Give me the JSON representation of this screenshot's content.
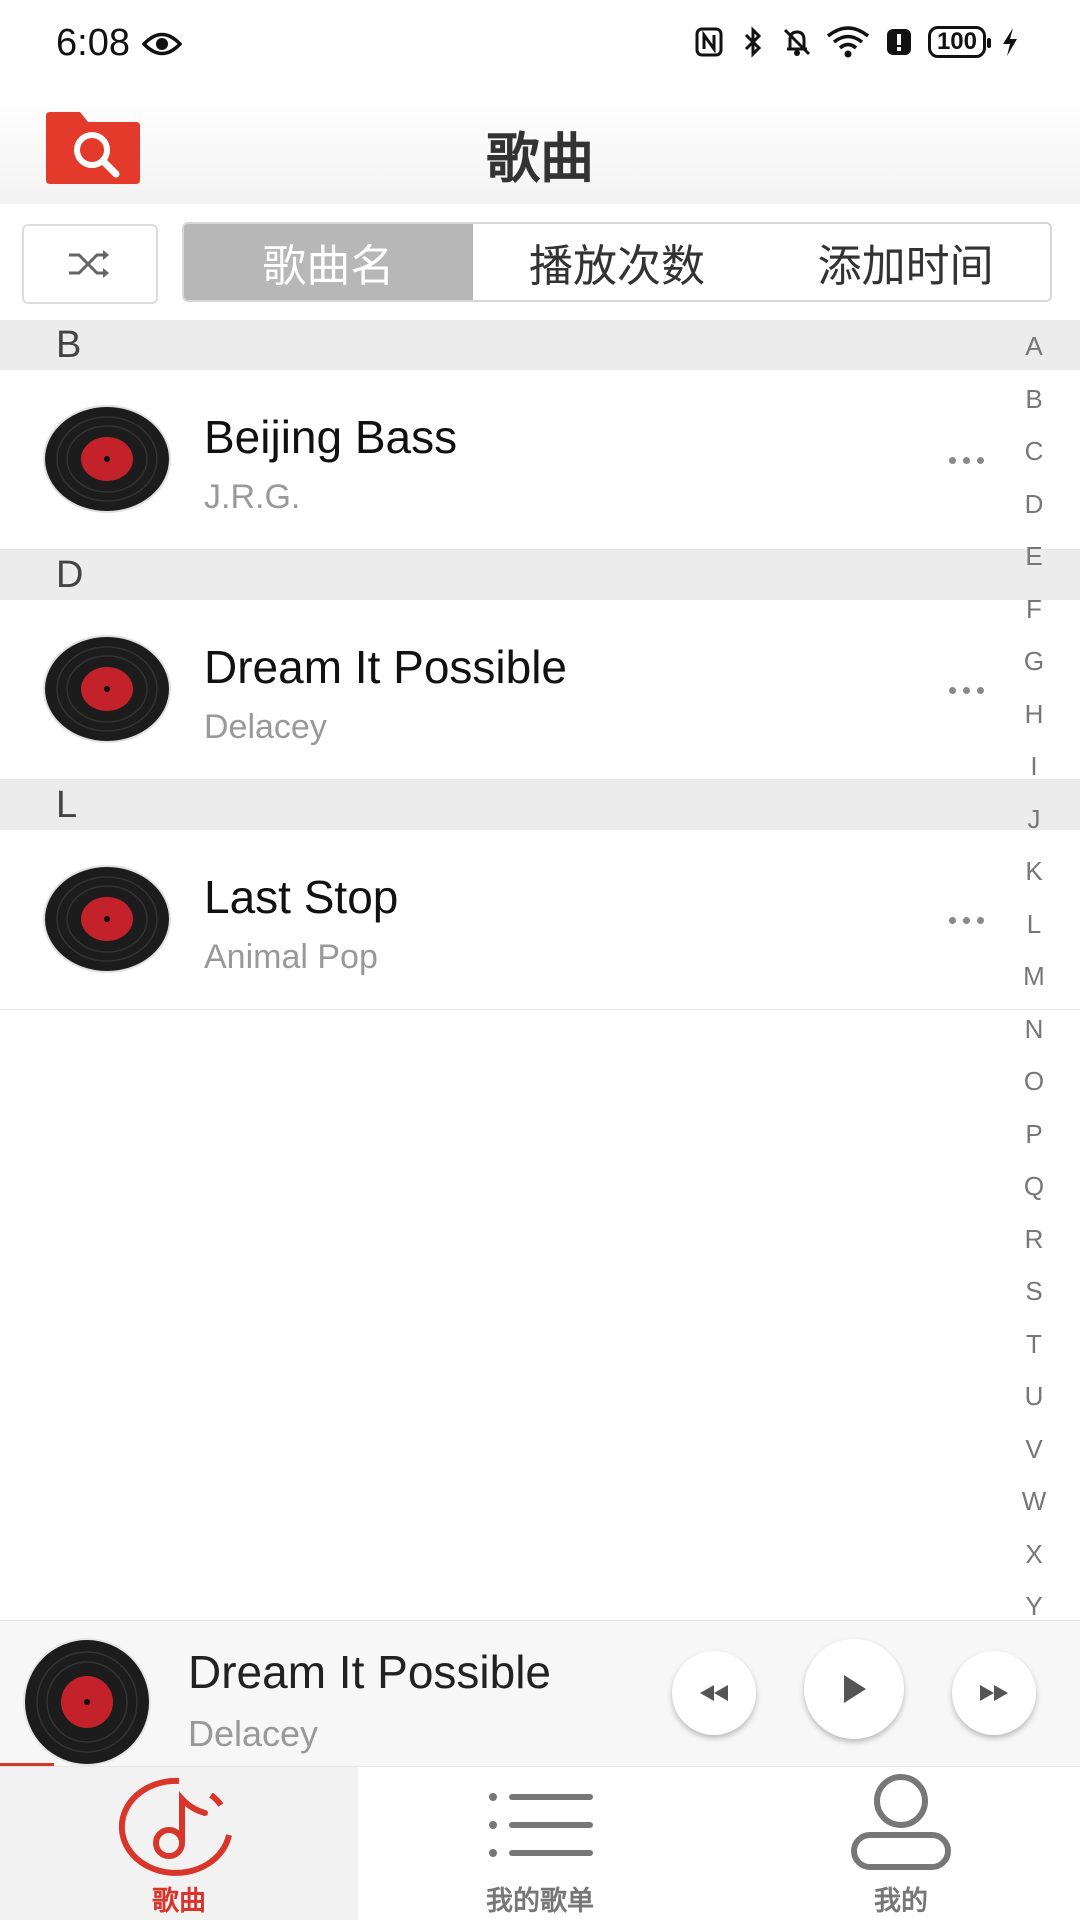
{
  "status_bar": {
    "time": "6:08",
    "battery": "100",
    "icons": [
      "eye-icon",
      "nfc-icon",
      "bluetooth-icon",
      "mute-icon",
      "wifi-icon",
      "alert-icon",
      "battery-icon",
      "charging-icon"
    ]
  },
  "header": {
    "title": "歌曲",
    "left_icon": "folder-search-icon"
  },
  "sort": {
    "shuffle_icon": "shuffle-icon",
    "options": [
      "歌曲名",
      "播放次数",
      "添加时间"
    ],
    "active_index": 0
  },
  "sections": [
    {
      "letter": "B",
      "songs": [
        {
          "title": "Beijing Bass",
          "artist": "J.R.G."
        }
      ]
    },
    {
      "letter": "D",
      "songs": [
        {
          "title": "Dream It Possible",
          "artist": "Delacey"
        }
      ]
    },
    {
      "letter": "L",
      "songs": [
        {
          "title": "Last Stop",
          "artist": "Animal Pop"
        }
      ]
    }
  ],
  "alphabet": [
    "A",
    "B",
    "C",
    "D",
    "E",
    "F",
    "G",
    "H",
    "I",
    "J",
    "K",
    "L",
    "M",
    "N",
    "O",
    "P",
    "Q",
    "R",
    "S",
    "T",
    "U",
    "V",
    "W",
    "X",
    "Y"
  ],
  "now_playing": {
    "title": "Dream It Possible",
    "artist": "Delacey",
    "progress": 0.05
  },
  "bottom_nav": [
    {
      "label": "歌曲",
      "icon": "music-note-icon",
      "active": true
    },
    {
      "label": "我的歌单",
      "icon": "playlist-icon",
      "active": false
    },
    {
      "label": "我的",
      "icon": "profile-icon",
      "active": false
    }
  ],
  "colors": {
    "accent": "#d9352b",
    "segment_active": "#b7b7b7",
    "section_bg": "#ececec"
  }
}
